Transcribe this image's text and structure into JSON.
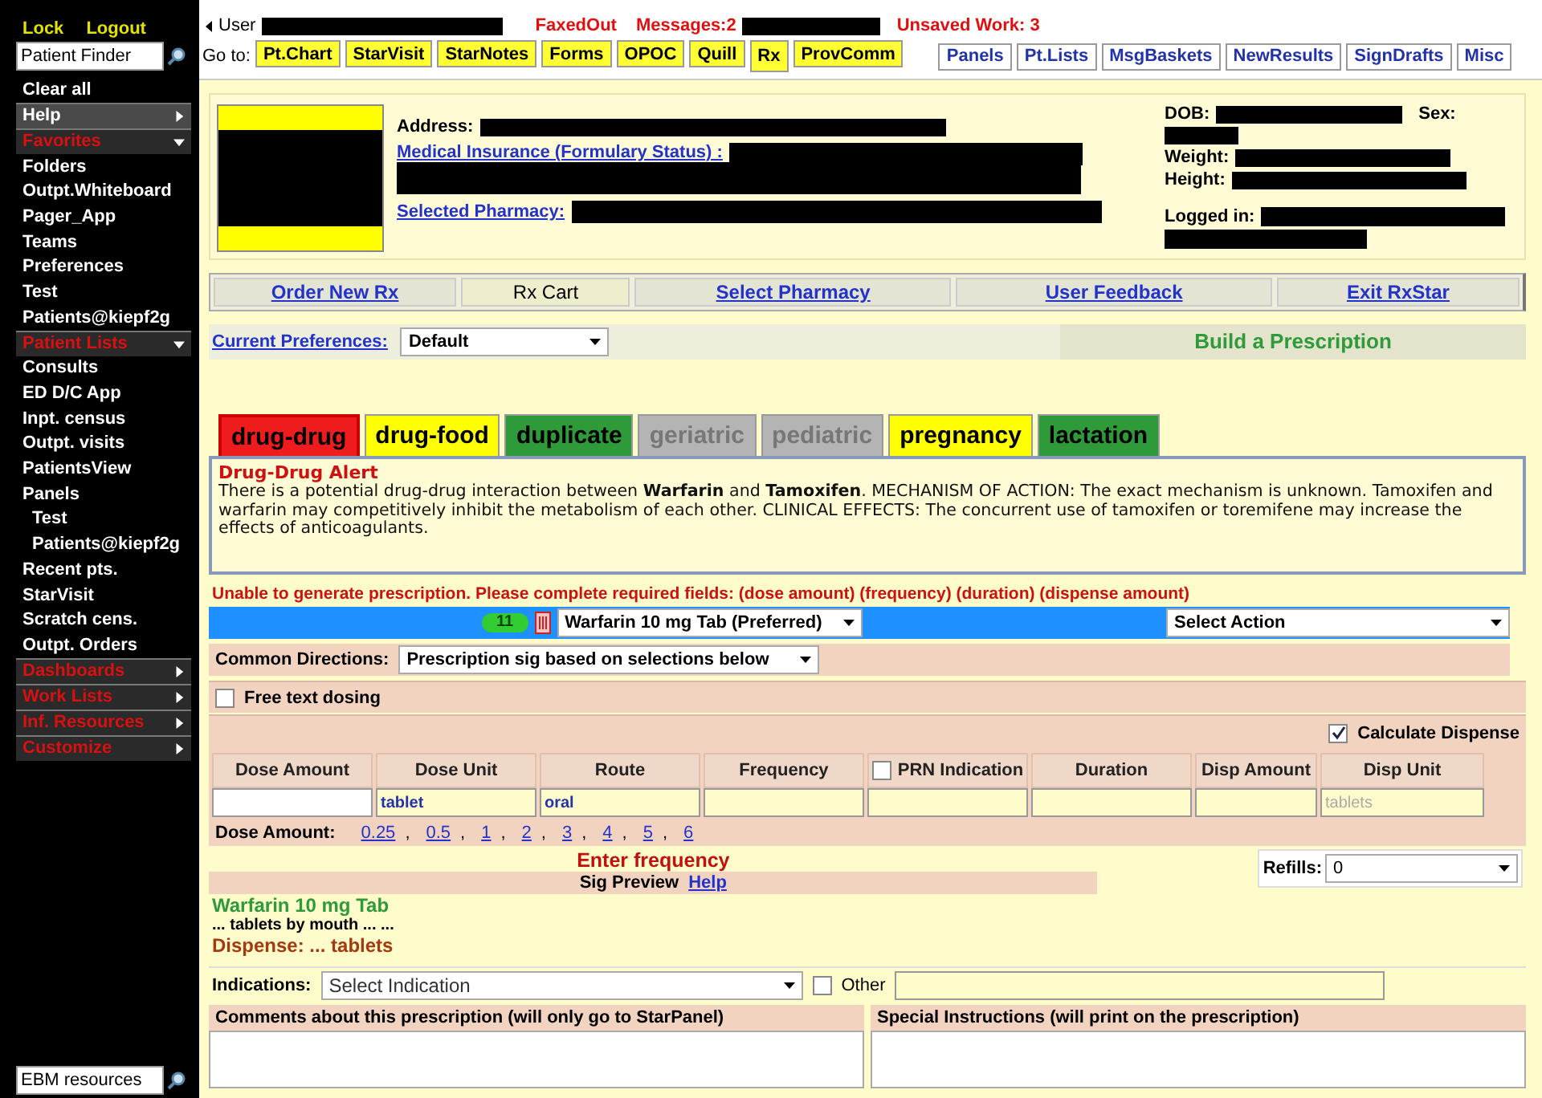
{
  "sidebar": {
    "top_links": [
      "Lock",
      "Logout"
    ],
    "patient_finder": {
      "placeholder": "Patient Finder"
    },
    "items": [
      {
        "kind": "action",
        "label": "Clear all"
      },
      {
        "kind": "menu",
        "label": "Help",
        "expanded": false
      },
      {
        "kind": "section",
        "label": "Favorites",
        "expanded": true
      },
      {
        "kind": "link",
        "label": "Folders"
      },
      {
        "kind": "link",
        "label": "Outpt.Whiteboard"
      },
      {
        "kind": "link",
        "label": "Pager_App"
      },
      {
        "kind": "link",
        "label": "Teams"
      },
      {
        "kind": "link",
        "label": "Preferences"
      },
      {
        "kind": "link",
        "label": "Test"
      },
      {
        "kind": "link",
        "label": "Patients@kiepf2g"
      },
      {
        "kind": "section",
        "label": "Patient Lists",
        "expanded": true
      },
      {
        "kind": "link",
        "label": "Consults"
      },
      {
        "kind": "link",
        "label": "ED D/C App"
      },
      {
        "kind": "link",
        "label": "Inpt. census"
      },
      {
        "kind": "link",
        "label": "Outpt. visits"
      },
      {
        "kind": "link",
        "label": "PatientsView"
      },
      {
        "kind": "link",
        "label": "Panels"
      },
      {
        "kind": "sublink",
        "label": "Test"
      },
      {
        "kind": "sublink",
        "label": "Patients@kiepf2g"
      },
      {
        "kind": "link",
        "label": "Recent pts."
      },
      {
        "kind": "link",
        "label": "StarVisit"
      },
      {
        "kind": "link",
        "label": "Scratch cens."
      },
      {
        "kind": "link",
        "label": "Outpt. Orders"
      },
      {
        "kind": "section",
        "label": "Dashboards",
        "expanded": false
      },
      {
        "kind": "section",
        "label": "Work Lists",
        "expanded": false
      },
      {
        "kind": "section",
        "label": "Inf. Resources",
        "expanded": false
      },
      {
        "kind": "section",
        "label": "Customize",
        "expanded": false
      }
    ],
    "ebm_search": {
      "placeholder": "EBM resources"
    }
  },
  "top_bar": {
    "user_label": "User",
    "statuses": [
      "FaxedOut",
      "Messages:2"
    ],
    "unsaved": "Unsaved Work: 3",
    "goto_label": "Go to:",
    "goto_buttons": [
      {
        "label": "Pt.Chart",
        "selected": false
      },
      {
        "label": "StarVisit",
        "selected": false
      },
      {
        "label": "StarNotes",
        "selected": false
      },
      {
        "label": "Forms",
        "selected": false
      },
      {
        "label": "OPOC",
        "selected": false
      },
      {
        "label": "Quill",
        "selected": false
      },
      {
        "label": "Rx",
        "selected": true
      },
      {
        "label": "ProvComm",
        "selected": false
      }
    ],
    "panel_buttons": [
      "Panels",
      "Pt.Lists",
      "MsgBaskets",
      "NewResults",
      "SignDrafts",
      "Misc"
    ]
  },
  "patient": {
    "address_label": "Address:",
    "insurance_link": "Medical Insurance (Formulary Status) :",
    "pharmacy_link": "Selected Pharmacy:",
    "dob_label": "DOB:",
    "sex_label": "Sex:",
    "weight_label": "Weight:",
    "height_label": "Height:",
    "logged_in_label": "Logged in:"
  },
  "nav_tabs": [
    {
      "label": "Order New Rx",
      "selected": false
    },
    {
      "label": "Rx Cart",
      "selected": true
    },
    {
      "label": "Select Pharmacy",
      "selected": false
    },
    {
      "label": "User Feedback",
      "selected": false
    },
    {
      "label": "Exit RxStar",
      "selected": false
    }
  ],
  "preferences": {
    "label": "Current Preferences:",
    "value": "Default",
    "heading": "Build a Prescription"
  },
  "alert_tabs": [
    {
      "label": "drug-drug",
      "color": "#ee1c1c",
      "selected": true,
      "disabled": false
    },
    {
      "label": "drug-food",
      "color": "#ffff00",
      "selected": false,
      "disabled": false
    },
    {
      "label": "duplicate",
      "color": "#2e9a3a",
      "selected": false,
      "disabled": false
    },
    {
      "label": "geriatric",
      "color": "#b4b4b4",
      "selected": false,
      "disabled": true
    },
    {
      "label": "pediatric",
      "color": "#b4b4b4",
      "selected": false,
      "disabled": true
    },
    {
      "label": "pregnancy",
      "color": "#ffff00",
      "selected": false,
      "disabled": false
    },
    {
      "label": "lactation",
      "color": "#2e9a3a",
      "selected": false,
      "disabled": false
    }
  ],
  "alert": {
    "title": "Drug-Drug Alert",
    "text": "There is a potential drug-drug interaction between **Warfarin** and **Tamoxifen**. MECHANISM OF ACTION: The exact mechanism is unknown. Tamoxifen and warfarin may competitively inhibit the metabolism of each other. CLINICAL EFFECTS: The concurrent use of tamoxifen or toremifene may increase the effects of anticoagulants."
  },
  "error": "Unable to generate prescription. Please complete required fields: (dose amount) (frequency) (duration) (dispense amount)",
  "drug_bar": {
    "badge": "11",
    "drug": "Warfarin 10 mg Tab (Preferred)",
    "action": "Select Action"
  },
  "common_directions": {
    "label": "Common Directions:",
    "value": "Prescription sig based on selections below"
  },
  "free_text_dosing": {
    "label": "Free text dosing",
    "checked": false
  },
  "calculate_dispense": {
    "label": "Calculate Dispense",
    "checked": true
  },
  "dose_table": [
    {
      "kind": "text",
      "label": "Dose Amount"
    },
    {
      "kind": "text",
      "label": "Dose Unit",
      "value": "tablet"
    },
    {
      "kind": "text",
      "label": "Route",
      "value": "oral"
    },
    {
      "kind": "text",
      "label": "Frequency"
    },
    {
      "kind": "checkbox",
      "label": "PRN Indication",
      "checked": false
    },
    {
      "kind": "text",
      "label": "Duration"
    },
    {
      "kind": "text",
      "label": "Disp Amount"
    },
    {
      "kind": "text",
      "label": "Disp Unit",
      "placeholder": "tablets"
    }
  ],
  "dose_amount": {
    "label": "Dose Amount:",
    "options": [
      "0.25",
      "0.5",
      "1",
      "2",
      "3",
      "4",
      "5",
      "6"
    ],
    "separator": ","
  },
  "frequency_prompt": "Enter frequency",
  "refills": {
    "label": "Refills:",
    "value": "0"
  },
  "sig_preview": {
    "label": "Sig Preview",
    "help": "Help"
  },
  "preview": {
    "drug": "Warfarin 10 mg Tab",
    "sig": "... tablets by mouth ... ...",
    "dispense": "Dispense: ... tablets"
  },
  "indications": {
    "label": "Indications:",
    "value": "Select Indication",
    "other_label": "Other",
    "other_checked": false
  },
  "comments_label": "Comments about this prescription (will only go to StarPanel)",
  "instructions_label": "Special Instructions (will print on the prescription)"
}
